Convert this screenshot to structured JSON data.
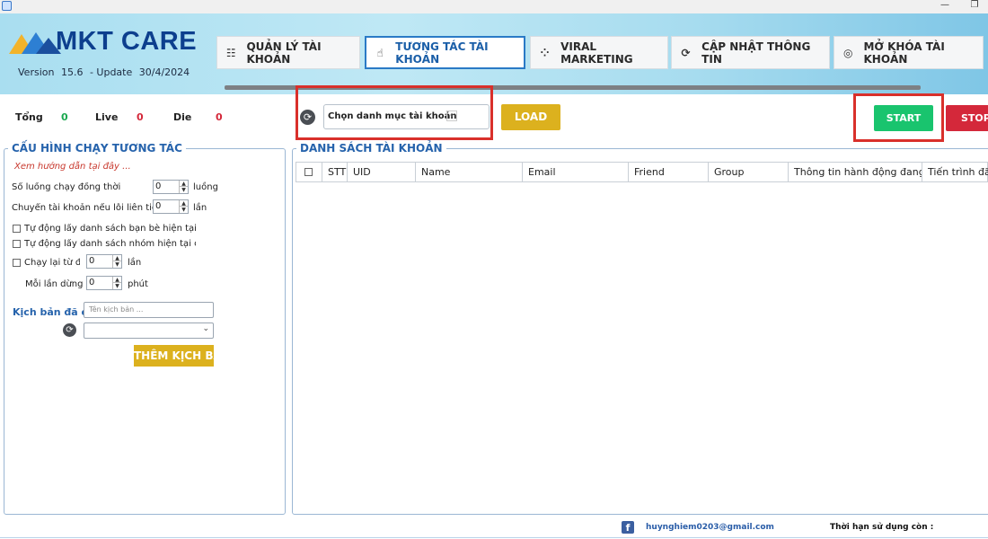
{
  "window": {
    "minimize_glyph": "—",
    "restore_glyph": "❐"
  },
  "brand": {
    "name": "MKT CARE",
    "version_label": "Version",
    "version": "15.6",
    "update_label": "- Update",
    "update_date": "30/4/2024"
  },
  "nav": [
    {
      "label": "QUẢN LÝ TÀI KHOẢN",
      "icon": "list-settings-icon",
      "glyph": "☷"
    },
    {
      "label": "TƯƠNG TÁC TÀI KHOẢN",
      "icon": "touch-icon",
      "glyph": "☝"
    },
    {
      "label": "VIRAL MARKETING",
      "icon": "apps-icon",
      "glyph": "⁘"
    },
    {
      "label": "CẬP NHẬT THÔNG TIN",
      "icon": "refresh-settings-icon",
      "glyph": "⟳"
    },
    {
      "label": "MỞ KHÓA TÀI KHOẢN",
      "icon": "fingerprint-icon",
      "glyph": "◎"
    }
  ],
  "stats": {
    "total_label": "Tổng",
    "total": "0",
    "live_label": "Live",
    "live": "0",
    "die_label": "Die",
    "die": "0"
  },
  "toolbar": {
    "category_value": "Chọn danh mục tài khoản",
    "load_label": "LOAD",
    "start_label": "START",
    "stop_label": "STOP"
  },
  "config": {
    "title": "CẤU HÌNH CHẠY TƯƠNG TÁC",
    "guide_link": "Xem hướng dẫn tại đây ...",
    "threads_label": "Số luồng chạy đồng thời",
    "threads_value": "0",
    "threads_unit": "luồng",
    "switch_label": "Chuyển tài khoản nếu lỗi liên tiếp",
    "switch_value": "0",
    "switch_unit": "lần",
    "auto_friends_label": "Tự động lấy danh sách bạn bè hiện tại của",
    "auto_groups_label": "Tự động lấy danh sách nhóm hiện tại của",
    "rerun_label": "Chạy lại từ đầu",
    "rerun_value": "0",
    "rerun_unit": "lần",
    "pause_label": "Mỗi lần dừng",
    "pause_value": "0",
    "pause_unit": "phút",
    "script_label": "Kịch bản đã chọn",
    "script_placeholder": "Tên kịch bản ...",
    "add_script_label": "THÊM KỊCH BẢN"
  },
  "accounts": {
    "title": "DANH SÁCH TÀI KHOẢN",
    "columns": [
      "STT",
      "UID",
      "Name",
      "Email",
      "Friend",
      "Group",
      "Thông tin hành động đang",
      "Tiến trình đã chạy"
    ]
  },
  "footer": {
    "email": "huynghiem0203@gmail.com",
    "expiry_label": "Thời hạn sử dụng còn :"
  },
  "colors": {
    "accent": "#2663ac",
    "load": "#dcb11e",
    "start": "#19c46e",
    "stop": "#d4283a",
    "highlight": "#d9302b"
  }
}
